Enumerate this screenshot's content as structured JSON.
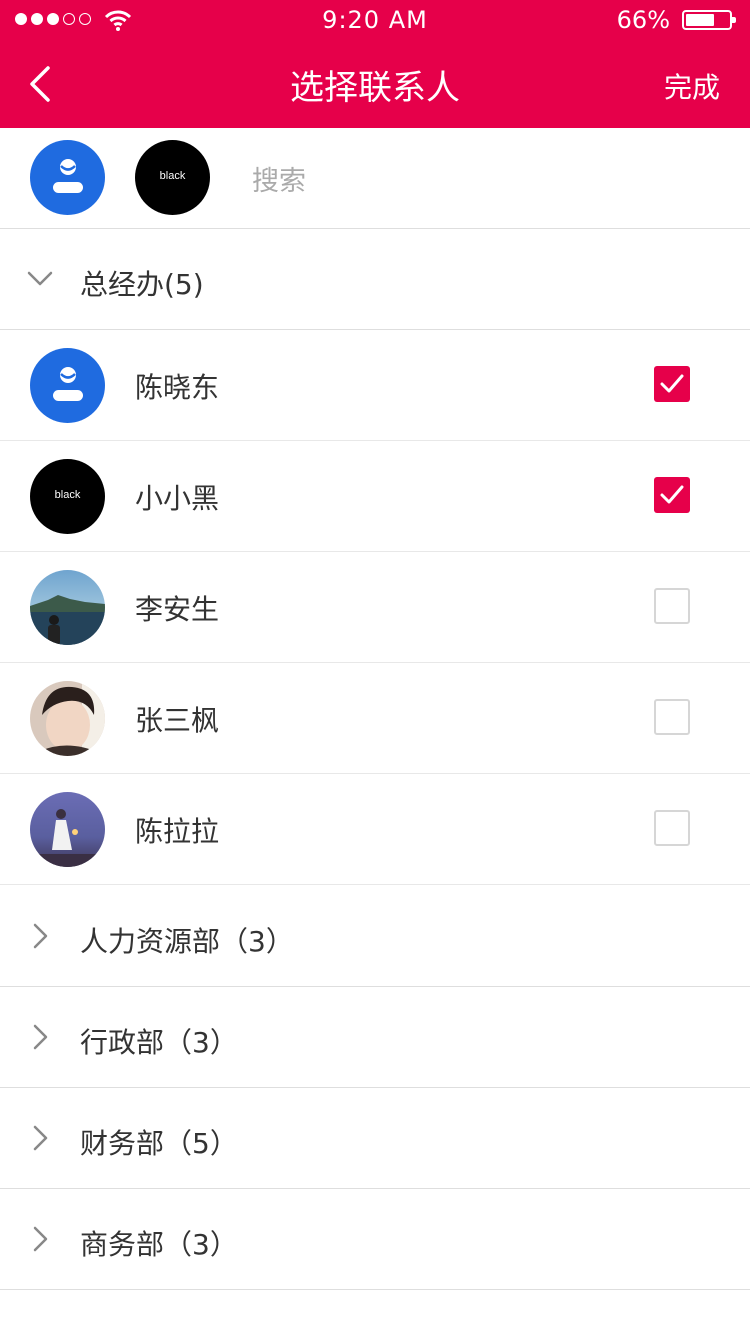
{
  "status_bar": {
    "time": "9:20 AM",
    "battery": "66%",
    "battery_level": 0.66
  },
  "nav": {
    "title": "选择联系人",
    "done": "完成"
  },
  "selected": {
    "avatars": [
      {
        "type": "default-user"
      },
      {
        "type": "black",
        "text": "black"
      }
    ],
    "search_placeholder": "搜索"
  },
  "groups": [
    {
      "label": "总经办(5)",
      "expanded": true,
      "contacts": [
        {
          "name": "陈晓东",
          "avatar": "default-user",
          "checked": true
        },
        {
          "name": "小小黑",
          "avatar": "black",
          "avatar_text": "black",
          "checked": true
        },
        {
          "name": "李安生",
          "avatar": "photo-sea",
          "checked": false
        },
        {
          "name": "张三枫",
          "avatar": "photo-man",
          "checked": false
        },
        {
          "name": "陈拉拉",
          "avatar": "photo-girl",
          "checked": false
        }
      ]
    },
    {
      "label": "人力资源部（3）",
      "expanded": false
    },
    {
      "label": "行政部（3）",
      "expanded": false
    },
    {
      "label": "财务部（5）",
      "expanded": false
    },
    {
      "label": "商务部（3）",
      "expanded": false
    }
  ],
  "colors": {
    "primary": "#e6004a",
    "avatar_blue": "#1f6be0",
    "divider": "#dedede"
  }
}
